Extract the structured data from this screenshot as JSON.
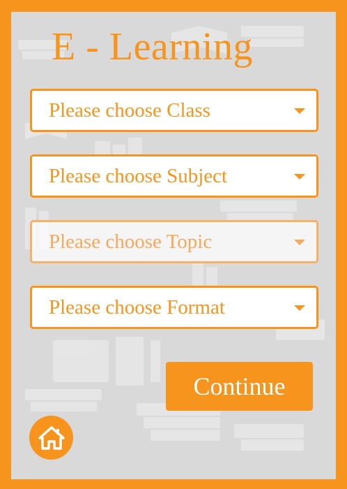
{
  "app": {
    "title": "E - Learning"
  },
  "form": {
    "class_select": {
      "selected": "Please choose Class",
      "disabled": false
    },
    "subject_select": {
      "selected": "Please choose Subject",
      "disabled": false
    },
    "topic_select": {
      "selected": "Please choose Topic",
      "disabled": true
    },
    "format_select": {
      "selected": "Please choose Format",
      "disabled": false
    }
  },
  "actions": {
    "continue_label": "Continue"
  },
  "icons": {
    "home": "home-icon",
    "caret": "chevron-down-icon"
  },
  "colors": {
    "accent": "#f7941e",
    "background": "#d9d9d9",
    "white": "#ffffff"
  }
}
